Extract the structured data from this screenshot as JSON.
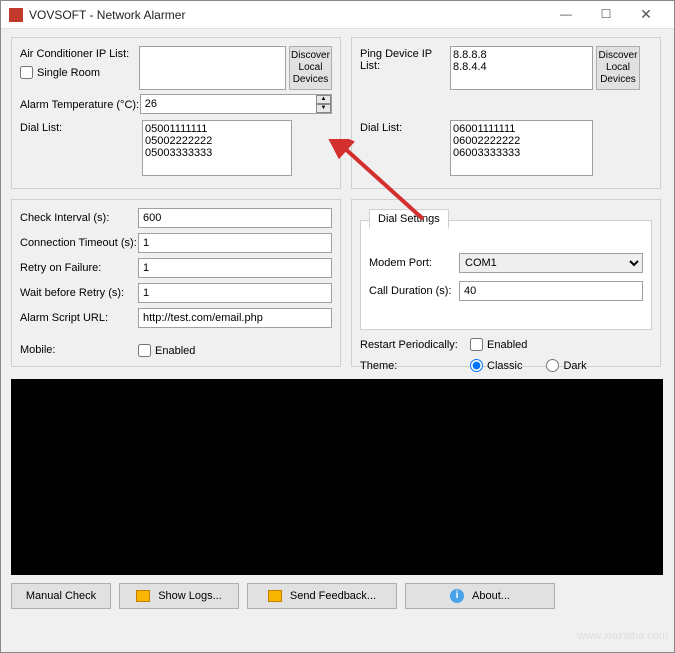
{
  "window": {
    "title": "VOVSOFT - Network Alarmer"
  },
  "left_panel": {
    "ac_ip_label": "Air Conditioner IP List:",
    "ac_ip_value": "",
    "single_room_label": "Single Room",
    "single_room_checked": false,
    "discover_btn": "Discover\nLocal\nDevices",
    "alarm_temp_label": "Alarm Temperature (°C):",
    "alarm_temp_value": "26",
    "dial_list_label": "Dial List:",
    "dial_list_value": "05001111111\n05002222222\n05003333333"
  },
  "right_panel": {
    "ping_label": "Ping Device IP List:",
    "ping_value": "8.8.8.8\n8.8.4.4",
    "discover_btn": "Discover\nLocal\nDevices",
    "dial_list_label": "Dial List:",
    "dial_list_value": "06001111111\n06002222222\n06003333333"
  },
  "settings": {
    "check_interval_label": "Check Interval (s):",
    "check_interval_value": "600",
    "conn_timeout_label": "Connection Timeout (s):",
    "conn_timeout_value": "1",
    "retry_label": "Retry on Failure:",
    "retry_value": "1",
    "wait_retry_label": "Wait before Retry (s):",
    "wait_retry_value": "1",
    "alarm_url_label": "Alarm Script URL:",
    "alarm_url_value": "http://test.com/email.php",
    "mobile_label": "Mobile:",
    "mobile_enabled_label": "Enabled",
    "mobile_enabled": false
  },
  "dial_settings": {
    "tab_label": "Dial Settings",
    "modem_port_label": "Modem Port:",
    "modem_port_value": "COM1",
    "call_duration_label": "Call Duration (s):",
    "call_duration_value": "40"
  },
  "options": {
    "restart_label": "Restart Periodically:",
    "restart_enabled_label": "Enabled",
    "restart_enabled": false,
    "theme_label": "Theme:",
    "theme_classic": "Classic",
    "theme_dark": "Dark",
    "theme_selected": "Classic"
  },
  "buttons": {
    "manual_check": "Manual Check",
    "show_logs": "Show Logs...",
    "send_feedback": "Send Feedback...",
    "about": "About..."
  },
  "watermark": "下载吧",
  "watermark2": "www.xiazaiba.com"
}
